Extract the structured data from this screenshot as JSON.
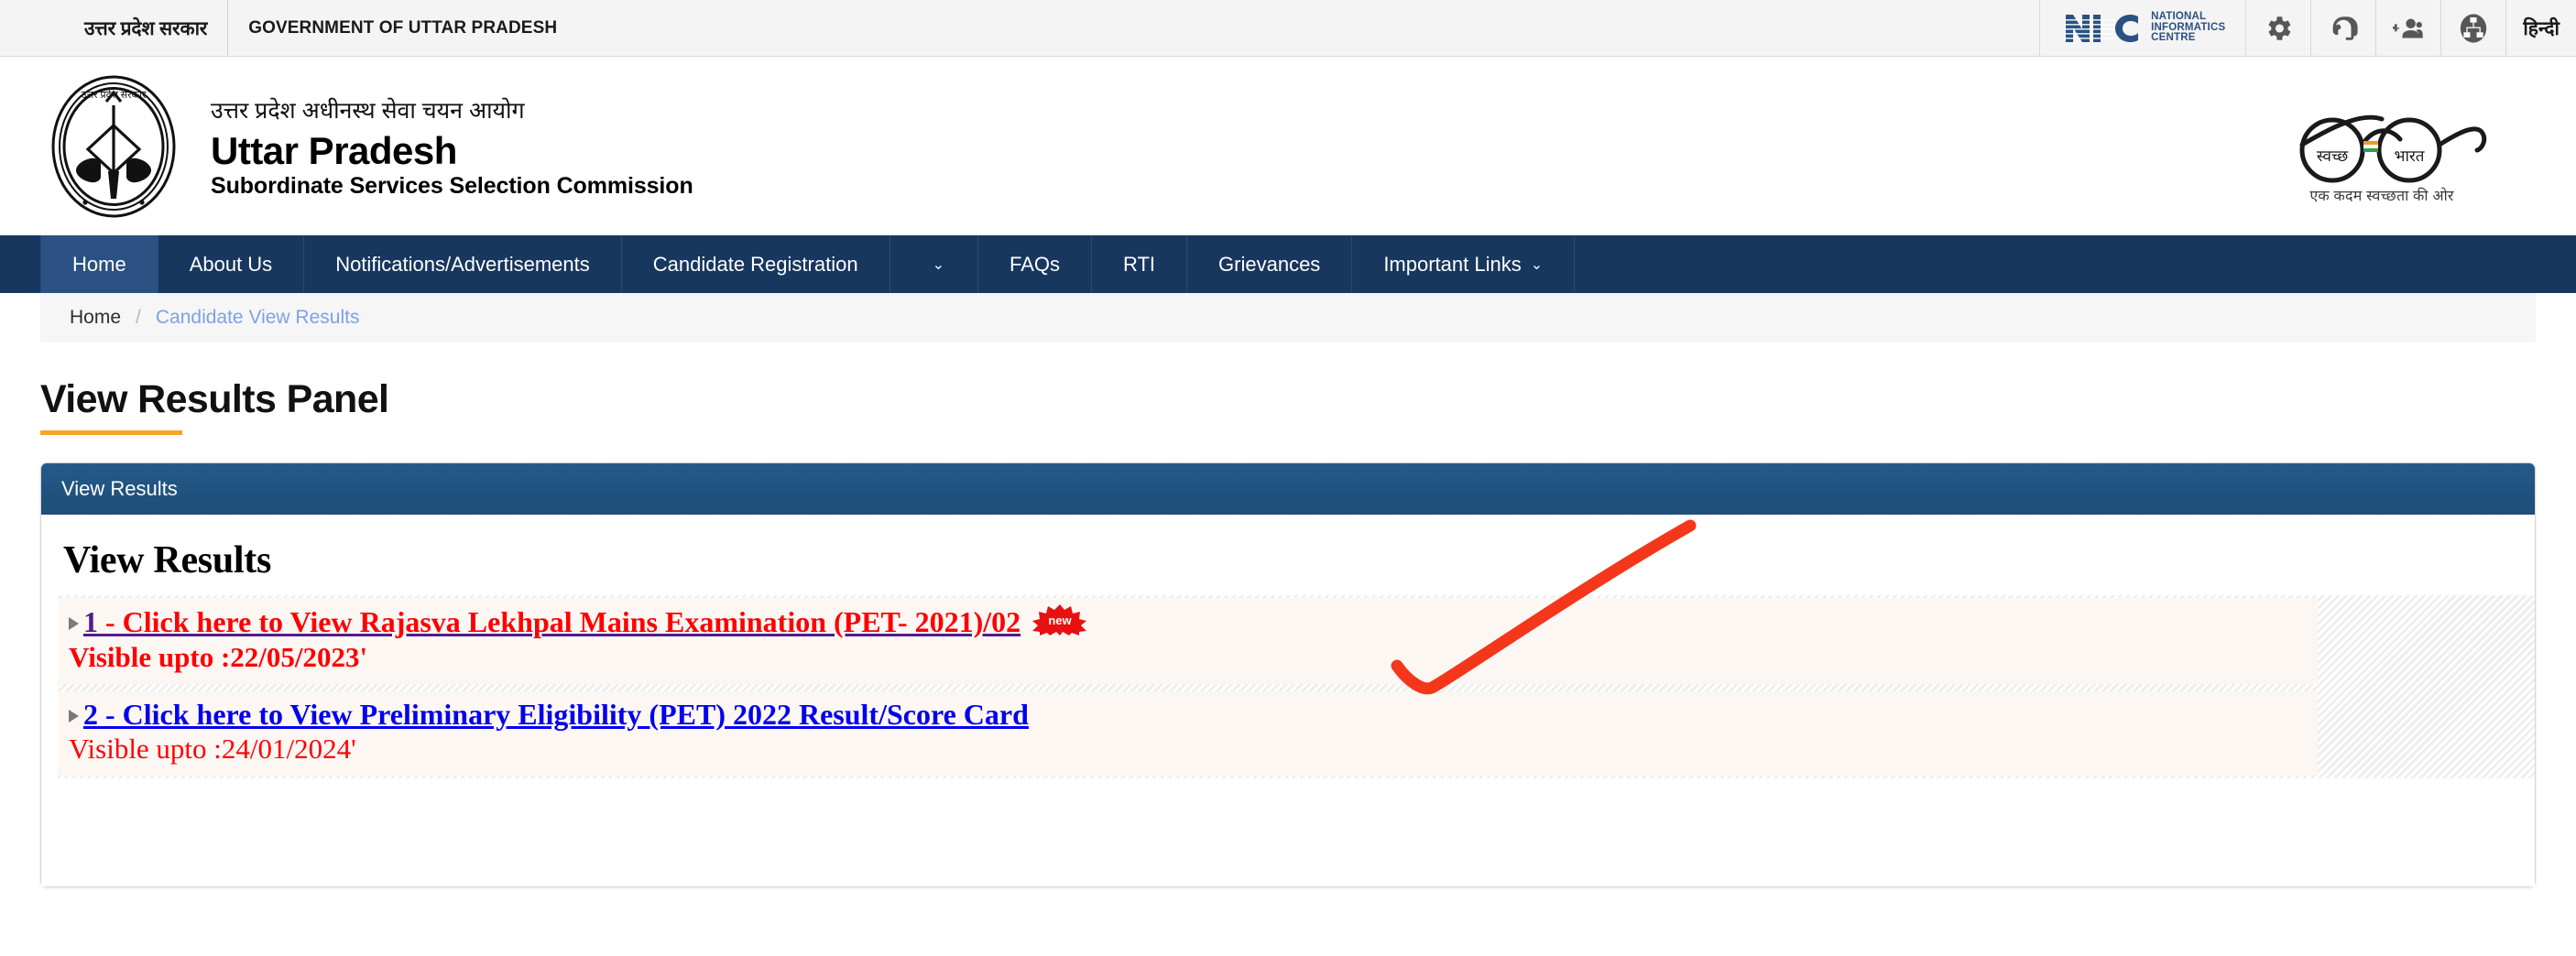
{
  "topbar": {
    "gov_hindi": "उत्तर प्रदेश सरकार",
    "gov_english": "GOVERNMENT OF UTTAR PRADESH",
    "nic": {
      "abbr": "NIC",
      "line1": "NATIONAL",
      "line2": "INFORMATICS",
      "line3": "CENTRE"
    },
    "icons": [
      {
        "name": "gear-icon",
        "label": "Settings"
      },
      {
        "name": "headset-icon",
        "label": "Support"
      },
      {
        "name": "add-user-icon",
        "label": "Add User"
      },
      {
        "name": "sitemap-icon",
        "label": "Site Map"
      }
    ],
    "language_link": "हिन्दी"
  },
  "header": {
    "emblem_alt": "Uttar Pradesh Government Emblem",
    "title_hindi": "उत्तर प्रदेश अधीनस्थ सेवा चयन आयोग",
    "title_line1": "Uttar Pradesh",
    "title_line2": "Subordinate Services Selection Commission",
    "swachh": {
      "left_word": "स्वच्छ",
      "right_word": "भारत",
      "tagline": "एक कदम स्वच्छता की ओर"
    }
  },
  "nav": {
    "items": [
      {
        "label": "Home",
        "active": true,
        "caret": false
      },
      {
        "label": "About Us",
        "active": false,
        "caret": false
      },
      {
        "label": "Notifications/Advertisements",
        "active": false,
        "caret": false
      },
      {
        "label": "Candidate Registration",
        "active": false,
        "caret": false
      },
      {
        "label": "",
        "active": false,
        "caret": true
      },
      {
        "label": "FAQs",
        "active": false,
        "caret": false
      },
      {
        "label": "RTI",
        "active": false,
        "caret": false
      },
      {
        "label": "Grievances",
        "active": false,
        "caret": false
      },
      {
        "label": "Important Links",
        "active": false,
        "caret": true
      }
    ],
    "caret_glyph": "⌄"
  },
  "breadcrumb": {
    "home": "Home",
    "separator": "/",
    "current": "Candidate View Results"
  },
  "page": {
    "title": "View Results Panel"
  },
  "panel": {
    "header_label": "View Results",
    "body_heading": "View Results",
    "results": [
      {
        "number": "1",
        "link_text": " - Click here to View Rajasva Lekhpal Mains Examination (PET- 2021)/02",
        "badge": "new",
        "badge_visible": true,
        "visibility": "Visible upto :22/05/2023'",
        "state": "visited"
      },
      {
        "number": "2",
        "link_text": " - Click here to View Preliminary Eligibility (PET) 2022 Result/Score Card",
        "badge": "",
        "badge_visible": false,
        "visibility": "Visible upto :24/01/2024'",
        "state": "unvisited"
      }
    ]
  },
  "annotation": {
    "name": "red-checkmark-annotation",
    "color": "#f4361a"
  },
  "colors": {
    "nav_bar": "#17375e",
    "nav_active": "#2b5183",
    "panel_header": "#21537f",
    "title_rule": "#f5a623",
    "visited_link": "#ff0000",
    "visited_underline": "#551a8b",
    "unvisited_link": "#0000ee",
    "row_background": "#fdf7f4",
    "breadcrumb_link": "#7ea1e8"
  }
}
